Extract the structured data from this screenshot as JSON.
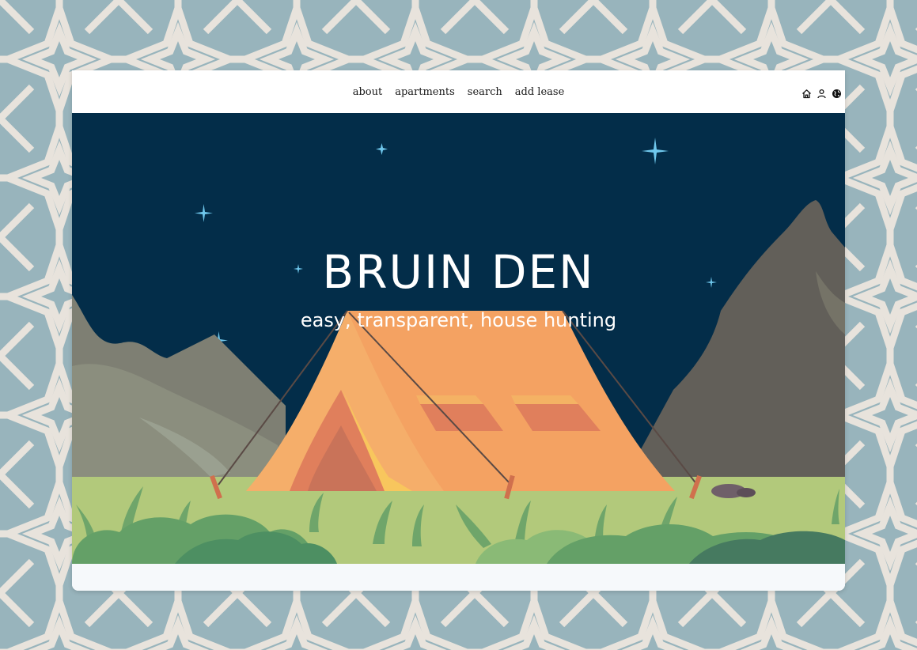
{
  "nav": {
    "links": [
      {
        "label": "about"
      },
      {
        "label": "apartments"
      },
      {
        "label": "search"
      },
      {
        "label": "add lease"
      }
    ],
    "icons": [
      "home-icon",
      "user-icon",
      "globe-icon"
    ]
  },
  "hero": {
    "title": "BRUIN DEN",
    "subtitle": "easy, transparent, house hunting"
  },
  "colors": {
    "pattern_bg": "#98b4bc",
    "pattern_line": "#e8e3dc",
    "sky": "#032d49",
    "mountain_left": "#7e7f73",
    "mountain_right": "#625f59",
    "grass": "#b2c97b",
    "tent": "#f4a262",
    "bush_dark": "#4d8f62"
  }
}
